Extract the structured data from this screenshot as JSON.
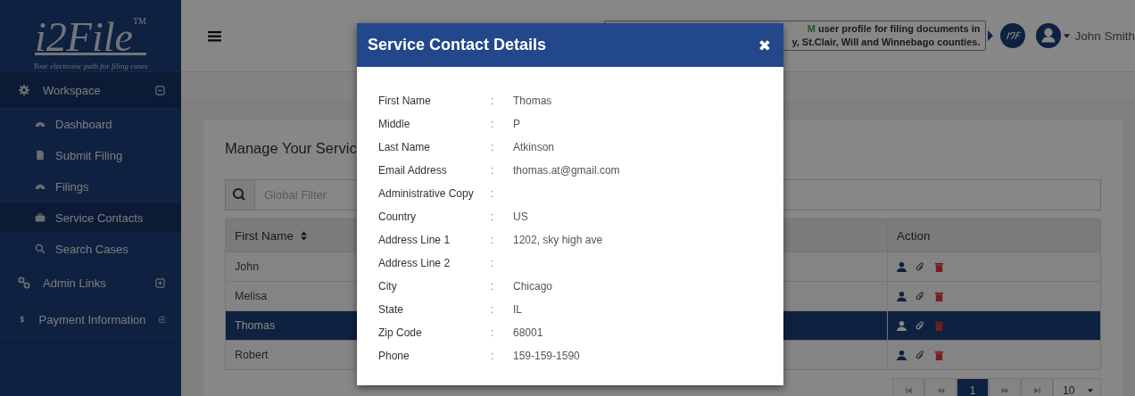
{
  "logo": {
    "name": "i2File$^{TM}$",
    "tagline": "Your electronic path for filing cases"
  },
  "sidebar": {
    "items": [
      {
        "label": "Workspace",
        "expanded": true,
        "children": [
          {
            "label": "Dashboard",
            "selected": false
          },
          {
            "label": "Submit Filing",
            "selected": false
          },
          {
            "label": "Filings",
            "selected": false
          },
          {
            "label": "Service Contacts",
            "selected": true
          },
          {
            "label": "Search Cases",
            "selected": false
          }
        ]
      },
      {
        "label": "Admin Links",
        "expanded": false
      },
      {
        "label": "Payment Information",
        "expanded": false
      }
    ]
  },
  "banner": {
    "highlight": "M",
    "line_1": "user profile for filing documents in",
    "line_2": "y, St.Clair, Will and Winnebago counties."
  },
  "user": {
    "name": "John Smith"
  },
  "page": {
    "title": "Manage Your Servic",
    "filter": {
      "placeholder": "Global Filter"
    },
    "table": {
      "columns": [
        "First Name",
        "Action"
      ],
      "rows": [
        {
          "first_name": "John",
          "selected": false
        },
        {
          "first_name": "Melisa",
          "selected": false
        },
        {
          "first_name": "Thomas",
          "selected": true
        },
        {
          "first_name": "Robert",
          "selected": false
        }
      ]
    },
    "pagination": {
      "pages": [
        {
          "label": "1",
          "selected": true
        }
      ],
      "page_size": "10"
    }
  },
  "modal": {
    "title": "Service Contact Details",
    "close": "✖",
    "fields": [
      {
        "label": "First Name",
        "separator": ":",
        "value": "Thomas"
      },
      {
        "label": "Middle",
        "separator": ":",
        "value": "P"
      },
      {
        "label": "Last Name",
        "separator": ":",
        "value": "Atkinson"
      },
      {
        "label": "Email Address",
        "separator": ":",
        "value": "thomas.at@gmail.com"
      },
      {
        "label": "Administrative Copy",
        "separator": ":"
      },
      {
        "label": "Country",
        "separator": ":",
        "value": "US"
      },
      {
        "label": "Address Line 1",
        "separator": ":",
        "value": "1202, sky high ave"
      },
      {
        "label": "Address Line 2",
        "separator": ":"
      },
      {
        "label": "City",
        "separator": ":",
        "value": "Chicago"
      },
      {
        "label": "State",
        "separator": ":",
        "value": "IL"
      },
      {
        "label": "Zip Code",
        "separator": ":",
        "value": "68001"
      },
      {
        "label": "Phone",
        "separator": ":",
        "value": "159-159-1590"
      }
    ]
  }
}
